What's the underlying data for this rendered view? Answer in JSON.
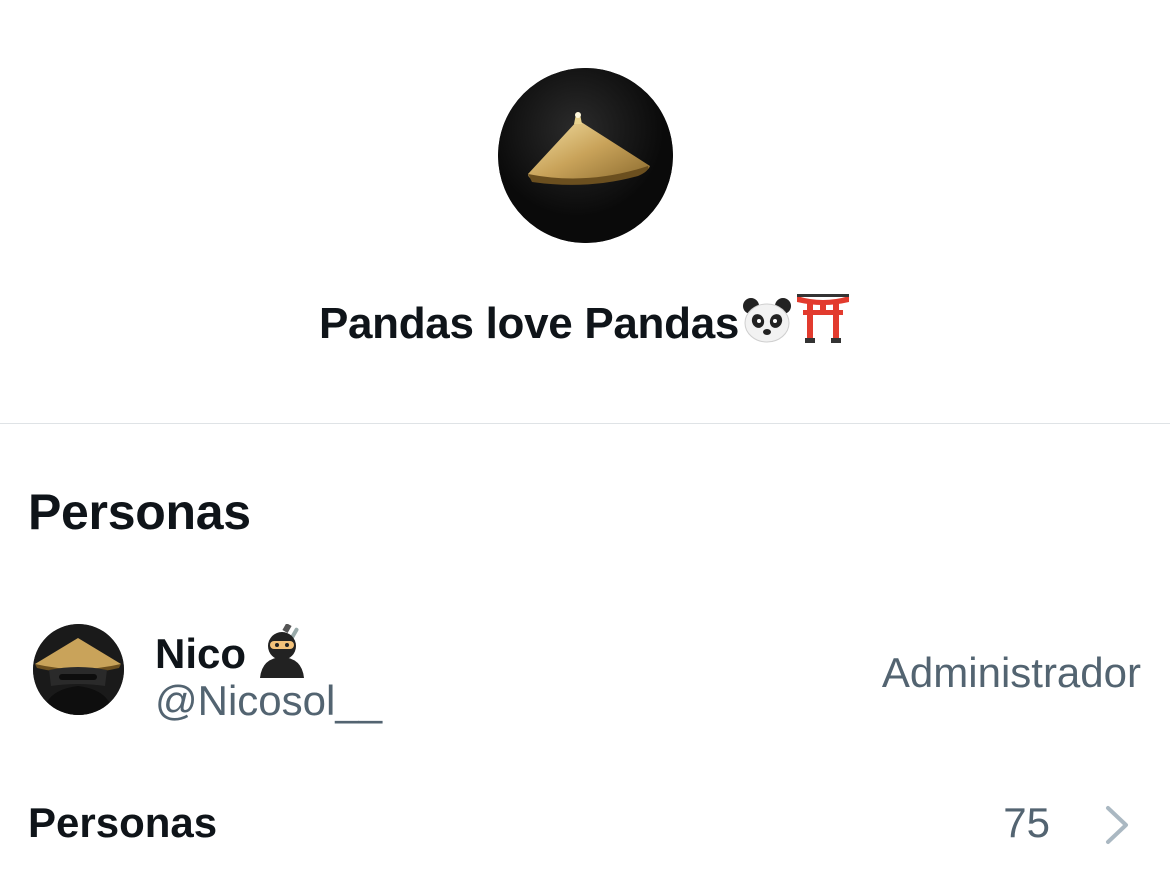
{
  "group": {
    "name": "Pandas love Pandas",
    "name_emojis": [
      "panda-face-emoji",
      "torii-gate-emoji"
    ],
    "avatar_icon": "bamboo-hat-icon"
  },
  "people_section": {
    "title": "Personas"
  },
  "members": [
    {
      "name": "Nico",
      "name_emoji": "ninja-emoji",
      "handle": "@Nicosol__",
      "role": "Administrador"
    }
  ],
  "people_row": {
    "label": "Personas",
    "count": "75",
    "chevron_icon": "chevron-right-icon"
  },
  "colors": {
    "text_primary": "#0f1419",
    "text_secondary": "#536471",
    "divider": "#dfe3e6",
    "chevron": "#aab8c2"
  }
}
